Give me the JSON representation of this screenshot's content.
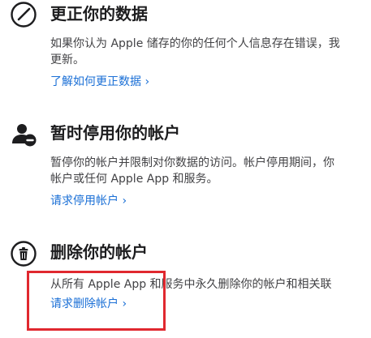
{
  "sections": [
    {
      "icon": "pencil-circle-icon",
      "title": "更正你的数据",
      "desc_lines": [
        "如果你认为 Apple 储存的你的任何个人信息存在错误，我",
        "更新。"
      ],
      "link": "了解如何更正数据 ›"
    },
    {
      "icon": "person-badge-icon",
      "title": "暂时停用你的帐户",
      "desc_lines": [
        "暂停你的帐户并限制对你数据的访问。帐户停用期间，你",
        "帐户或任何 Apple App 和服务。"
      ],
      "link": "请求停用帐户 ›"
    },
    {
      "icon": "trash-circle-icon",
      "title": "删除你的帐户",
      "desc_lines": [
        "从所有 Apple App 和服务中永久删除你的帐户和相关联"
      ],
      "link": "请求删除帐户 ›"
    }
  ],
  "colors": {
    "link": "#1a6fd6",
    "highlight": "#e0282f"
  }
}
